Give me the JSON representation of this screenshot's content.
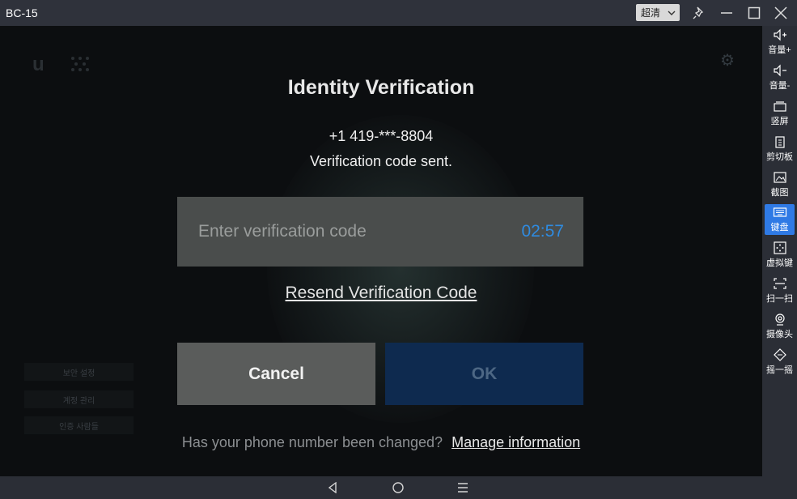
{
  "window": {
    "title": "BC-15",
    "quality_label": "超清"
  },
  "background": {
    "menu_items": [
      "보안 설정",
      "계정 관리",
      "인증 사람들"
    ]
  },
  "dialog": {
    "title": "Identity Verification",
    "phone": "+1 419-***-8804",
    "sent_text": "Verification code sent.",
    "input_placeholder": "Enter verification code",
    "input_value": "",
    "timer": "02:57",
    "resend_label": "Resend Verification Code",
    "cancel_label": "Cancel",
    "ok_label": "OK",
    "footer_question": "Has your phone number been changed?",
    "manage_link": "Manage information"
  },
  "sidebar": {
    "items": [
      {
        "label": "音量+",
        "icon": "volume-up-icon"
      },
      {
        "label": "音量-",
        "icon": "volume-down-icon"
      },
      {
        "label": "竖屏",
        "icon": "portrait-icon"
      },
      {
        "label": "剪切板",
        "icon": "clipboard-icon"
      },
      {
        "label": "截图",
        "icon": "screenshot-icon"
      },
      {
        "label": "键盘",
        "icon": "keyboard-icon",
        "active": true
      },
      {
        "label": "虚拟键",
        "icon": "virtual-key-icon"
      },
      {
        "label": "扫一扫",
        "icon": "scan-icon"
      },
      {
        "label": "摄像头",
        "icon": "camera-icon"
      },
      {
        "label": "摇一摇",
        "icon": "shake-icon"
      }
    ]
  },
  "colors": {
    "accent": "#2f7ae5",
    "timer": "#2f8be0",
    "ok_button": "#0e2a4f",
    "cancel_button": "#5a5c5b"
  }
}
